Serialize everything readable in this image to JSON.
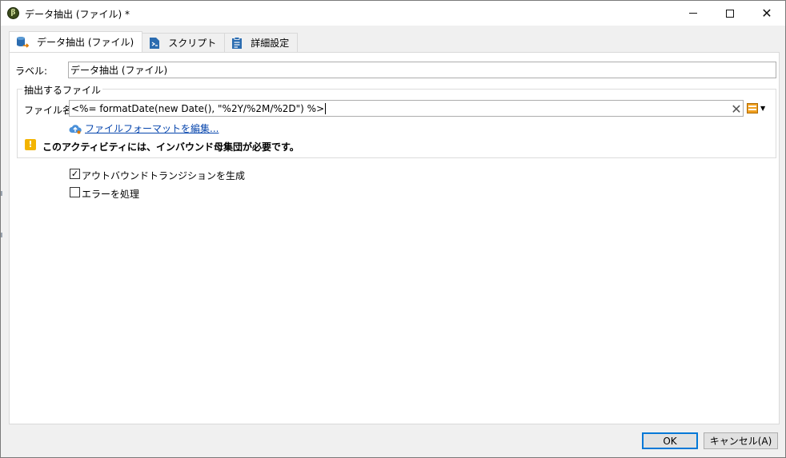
{
  "window": {
    "title": "データ抽出 (ファイル) *",
    "app_icon_glyph": "β",
    "controls": {
      "minimize": "minimize-icon",
      "maximize": "maximize-icon",
      "close": "close-icon"
    }
  },
  "tabs": [
    {
      "label": "データ抽出 (ファイル)",
      "icon": "database-extract-icon",
      "active": true
    },
    {
      "label": "スクリプト",
      "icon": "script-file-icon",
      "active": false
    },
    {
      "label": "詳細設定",
      "icon": "clipboard-icon",
      "active": false
    }
  ],
  "form": {
    "label_caption": "ラベル:",
    "label_value": "データ抽出 (ファイル)",
    "group_title": "抽出するファイル",
    "filename_caption": "ファイル名:",
    "filename_value": "<%= formatDate(new Date(), \"%2Y/%2M/%2D\") %>",
    "edit_format_link": "ファイルフォーマットを編集...",
    "warning_text": "このアクティビティには、インバウンド母集団が必要です。",
    "options": [
      {
        "label": "アウトバウンドトランジションを生成",
        "checked": true
      },
      {
        "label": "エラーを処理",
        "checked": false
      }
    ]
  },
  "buttons": {
    "ok": "OK",
    "cancel": "キャンセル(A)"
  },
  "colors": {
    "accent": "#0078d7",
    "link": "#0645ad",
    "warning": "#f3b400",
    "tab_icon_blue": "#2b6cb0"
  }
}
